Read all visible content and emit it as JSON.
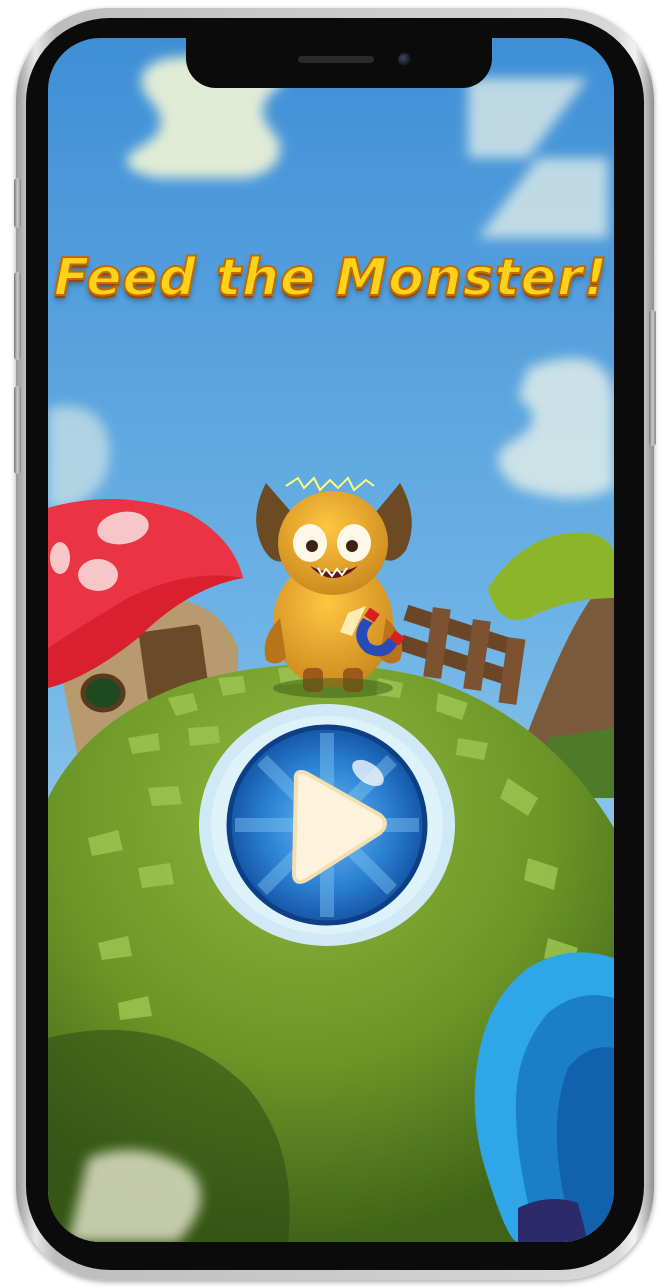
{
  "game": {
    "title": "Feed the Monster!",
    "play_button_label": "play"
  },
  "icons": {
    "play_button": "play-triangle-icon",
    "character": "monster-with-magnet"
  },
  "colors": {
    "sky": "#5aa3de",
    "title_fill": "#ffd21a",
    "title_outline": "#c06a00",
    "hill": "#6f9a2b",
    "play_ring": "#cfeaf6",
    "play_button": "#2a7ed0",
    "mushroom_cap": "#d8202f",
    "monster": "#e8a42a"
  }
}
